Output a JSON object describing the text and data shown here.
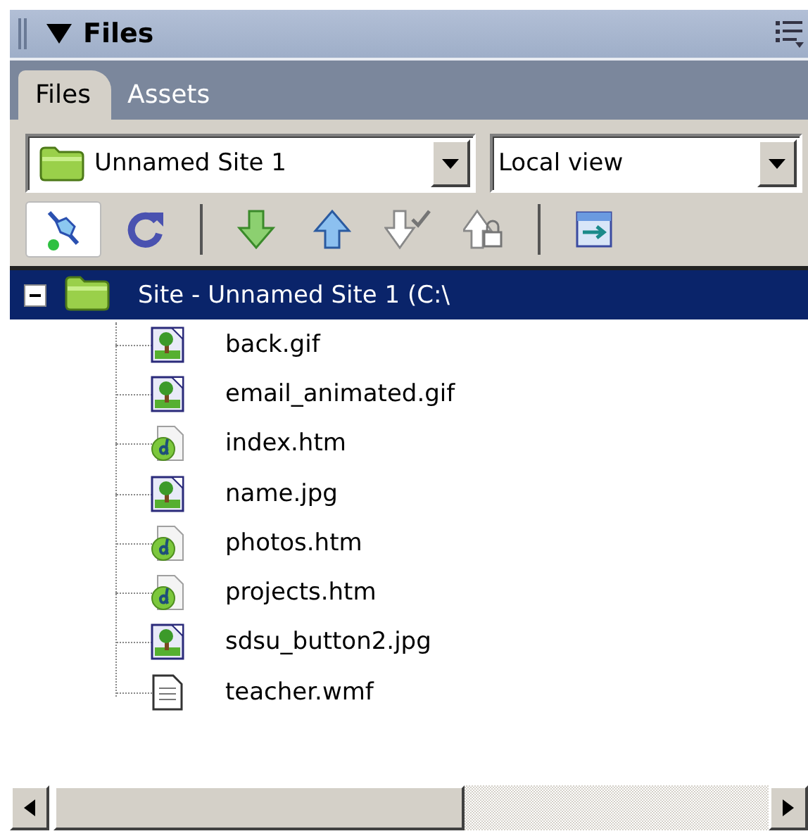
{
  "panel": {
    "title": "Files",
    "expanded": true
  },
  "tabs": [
    {
      "label": "Files",
      "selected": true
    },
    {
      "label": "Assets",
      "selected": false
    }
  ],
  "site_select": {
    "value": "Unnamed Site 1"
  },
  "view_select": {
    "value": "Local view"
  },
  "toolbar": [
    {
      "kind": "connect",
      "pressed": true,
      "disabled": false
    },
    {
      "kind": "refresh",
      "pressed": false,
      "disabled": false
    },
    {
      "kind": "separator"
    },
    {
      "kind": "get",
      "pressed": false,
      "disabled": false
    },
    {
      "kind": "put",
      "pressed": false,
      "disabled": false
    },
    {
      "kind": "check-out",
      "disabled": true
    },
    {
      "kind": "check-in",
      "disabled": true
    },
    {
      "kind": "separator"
    },
    {
      "kind": "expand",
      "pressed": false,
      "disabled": false
    }
  ],
  "tree": {
    "label": "Site - Unnamed Site 1 (C:\\",
    "expanded": true,
    "selected": true,
    "children": [
      {
        "name": "back.gif",
        "kind": "image"
      },
      {
        "name": "email_animated.gif",
        "kind": "image"
      },
      {
        "name": "index.htm",
        "kind": "html"
      },
      {
        "name": "name.jpg",
        "kind": "image"
      },
      {
        "name": "photos.htm",
        "kind": "html"
      },
      {
        "name": "projects.htm",
        "kind": "html"
      },
      {
        "name": "sdsu_button2.jpg",
        "kind": "image"
      },
      {
        "name": "teacher.wmf",
        "kind": "document"
      }
    ]
  }
}
